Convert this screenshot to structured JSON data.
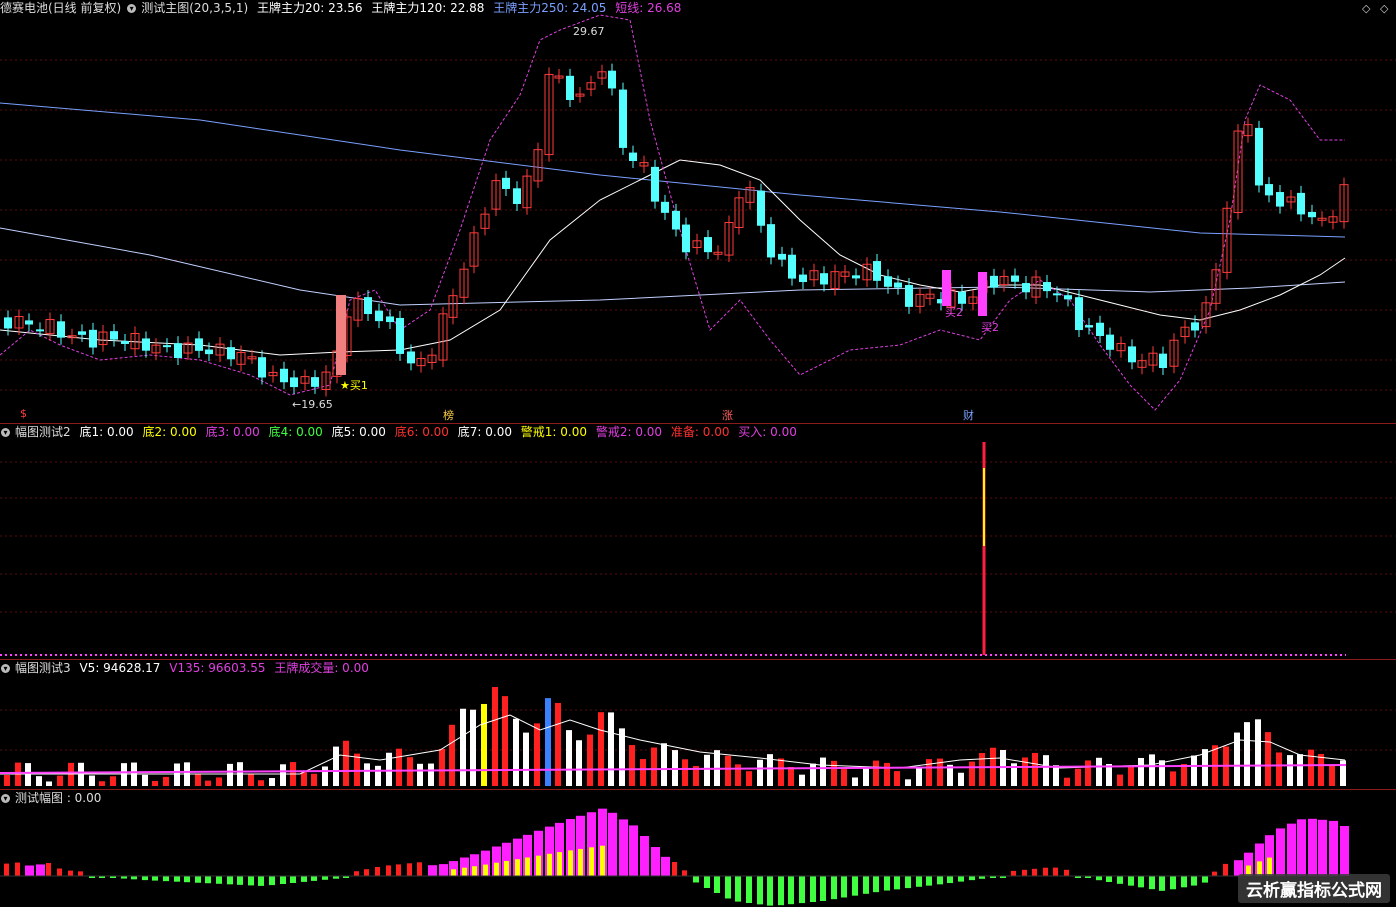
{
  "main": {
    "stock_name": "德赛电池(日线 前复权)",
    "indicator_name": "测试主图(20,3,5,1)",
    "legend": [
      {
        "label": "王牌主力20: 23.56",
        "color": "#ffffff"
      },
      {
        "label": "王牌主力120: 22.88",
        "color": "#ffffff"
      },
      {
        "label": "王牌主力250: 24.05",
        "color": "#7aa0ff"
      },
      {
        "label": "短线: 26.68",
        "color": "#e040e0"
      }
    ],
    "high_label": "29.67",
    "low_label": "←19.65",
    "signals": [
      "★买1",
      "买2",
      "买2"
    ],
    "event_tags": [
      "$",
      "榜",
      "涨",
      "财"
    ],
    "controls": [
      "◇",
      "◇"
    ]
  },
  "sub1": {
    "title": "幅图测试2",
    "items": [
      {
        "label": "底1: 0.00",
        "color": "#ffffff"
      },
      {
        "label": "底2: 0.00",
        "color": "#ffff00"
      },
      {
        "label": "底3: 0.00",
        "color": "#e040e0"
      },
      {
        "label": "底4: 0.00",
        "color": "#40ff40"
      },
      {
        "label": "底5: 0.00",
        "color": "#ffffff"
      },
      {
        "label": "底6: 0.00",
        "color": "#ff3030"
      },
      {
        "label": "底7: 0.00",
        "color": "#ffffff"
      },
      {
        "label": "警戒1: 0.00",
        "color": "#ffff00"
      },
      {
        "label": "警戒2: 0.00",
        "color": "#e040e0"
      },
      {
        "label": "准备: 0.00",
        "color": "#ff3030"
      },
      {
        "label": "买入: 0.00",
        "color": "#e040e0"
      }
    ]
  },
  "sub2": {
    "title": "幅图测试3",
    "items": [
      {
        "label": "V5: 94628.17",
        "color": "#ffffff"
      },
      {
        "label": "V135: 96603.55",
        "color": "#e040e0"
      },
      {
        "label": "王牌成交量: 0.00",
        "color": "#e040e0"
      }
    ]
  },
  "sub3": {
    "title": "测试幅图 : 0.00"
  },
  "watermark": "云析赢指标公式网",
  "colors": {
    "up": "#ff3c3c",
    "down": "#54ffff",
    "ma20": "#ffffff",
    "ma250": "#7aa0ff",
    "short": "#e040e0",
    "separator": "#8b1a1a"
  }
}
